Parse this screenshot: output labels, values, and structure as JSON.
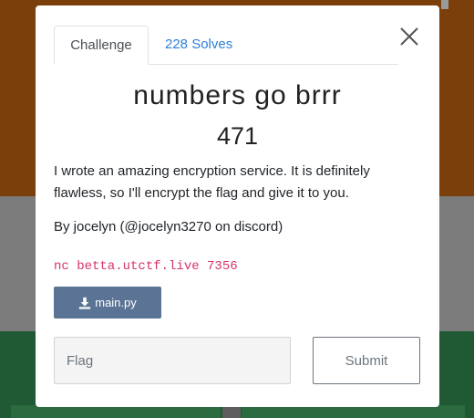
{
  "background": {
    "top_left_text": "...",
    "top_right_text": "..."
  },
  "modal": {
    "tabs": [
      {
        "label": "Challenge",
        "active": true
      },
      {
        "label": "228 Solves",
        "active": false
      }
    ],
    "title": "numbers go brrr",
    "points": "471",
    "description": "I wrote an amazing encryption service. It is definitely flawless, so I'll encrypt the flag and give it to you.",
    "author": "By jocelyn (@jocelyn3270 on discord)",
    "connection": "nc betta.utctf.live 7356",
    "file": {
      "label": "main.py",
      "icon": "download-icon"
    },
    "flag_input": {
      "placeholder": "Flag",
      "value": ""
    },
    "submit_label": "Submit"
  },
  "colors": {
    "tab_link": "#2f7fd8",
    "file_button": "#5b7495",
    "code_text": "#d6336c"
  }
}
